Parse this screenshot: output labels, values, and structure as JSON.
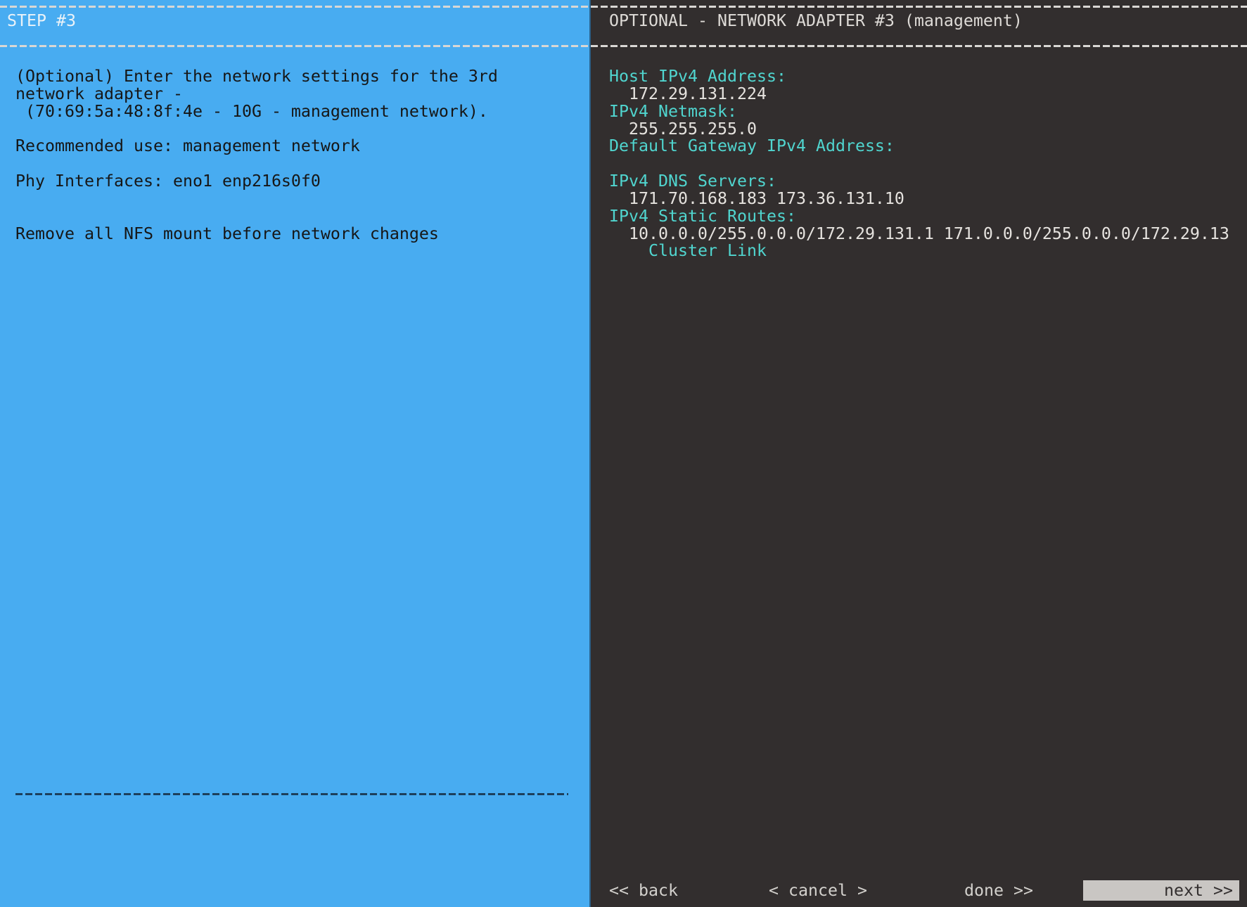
{
  "step_panel": {
    "title": "STEP #3",
    "lines": [
      "(Optional) Enter the network settings for the 3rd",
      "network adapter -",
      " (70:69:5a:48:8f:4e - 10G - management network).",
      "",
      "Recommended use: management network",
      "",
      "Phy Interfaces: eno1 enp216s0f0",
      "",
      "",
      "Remove all NFS mount before network changes"
    ]
  },
  "adapter_panel": {
    "title": "OPTIONAL - NETWORK ADAPTER #3 (management)",
    "fields": [
      {
        "kind": "label",
        "text": "Host IPv4 Address:"
      },
      {
        "kind": "value",
        "text": "  172.29.131.224"
      },
      {
        "kind": "label",
        "text": "IPv4 Netmask:"
      },
      {
        "kind": "value",
        "text": "  255.255.255.0"
      },
      {
        "kind": "label",
        "text": "Default Gateway IPv4 Address:"
      },
      {
        "kind": "blank",
        "text": ""
      },
      {
        "kind": "label",
        "text": "IPv4 DNS Servers:"
      },
      {
        "kind": "value",
        "text": "  171.70.168.183 173.36.131.10"
      },
      {
        "kind": "label",
        "text": "IPv4 Static Routes:"
      },
      {
        "kind": "value",
        "text": "  10.0.0.0/255.0.0.0/172.29.131.1 171.0.0.0/255.0.0.0/172.29.13"
      },
      {
        "kind": "option",
        "text": "    Cluster Link"
      }
    ]
  },
  "buttons": {
    "back": "<< back",
    "cancel": "< cancel >",
    "done": "done >>",
    "next": "next >>"
  },
  "colors": {
    "panel_blue": "#48ACF1",
    "panel_dark": "#322E2E",
    "label_cyan": "#50D5CF",
    "value_white": "#E6E3DF",
    "dash_light": "#D9D7D4",
    "separator_dark": "#1D3F5B",
    "selected_button_bg": "#C9C6C3"
  }
}
